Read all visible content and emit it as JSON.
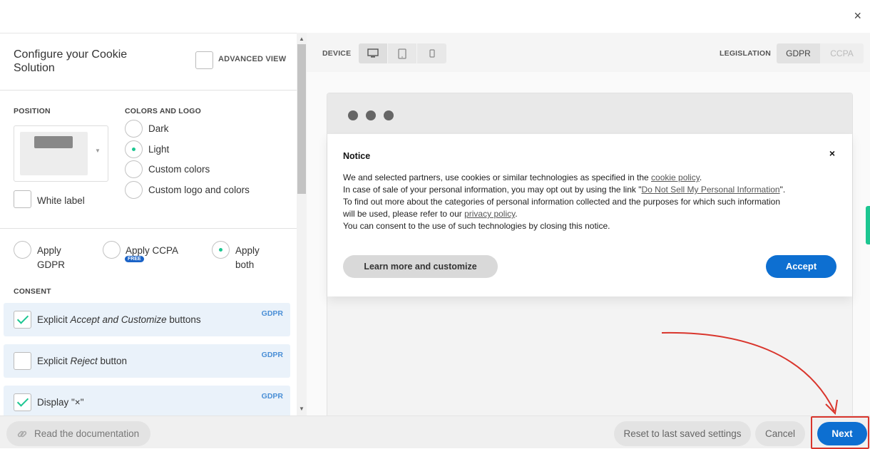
{
  "window": {
    "close_label": "×"
  },
  "left": {
    "title": "Configure your Cookie Solution",
    "advanced_view_label": "ADVANCED VIEW",
    "position": {
      "label": "POSITION",
      "white_label_text": "White label"
    },
    "colors": {
      "label": "COLORS AND LOGO",
      "options": [
        "Dark",
        "Light",
        "Custom colors",
        "Custom logo and colors"
      ],
      "selected": "Light"
    },
    "legislation_options": {
      "gdpr_line1": "Apply",
      "gdpr_line2": "GDPR",
      "ccpa": "Apply CCPA",
      "free_badge": "FREE",
      "both_line1": "Apply",
      "both_line2": "both",
      "selected": "both"
    },
    "consent": {
      "label": "CONSENT",
      "items": [
        {
          "pre": "Explicit ",
          "em": "Accept and Customize",
          "post": " buttons",
          "tag": "GDPR",
          "checked": true
        },
        {
          "pre": "Explicit ",
          "em": "Reject",
          "post": " button",
          "tag": "GDPR",
          "checked": false
        },
        {
          "pre": "Display \"×\"",
          "em": "",
          "post": "",
          "tag": "GDPR",
          "checked": true
        }
      ]
    }
  },
  "toolbar": {
    "device_label": "DEVICE",
    "devices": [
      "desktop-icon",
      "tablet-icon",
      "mobile-icon"
    ],
    "legislation_label": "LEGISLATION",
    "legislations": [
      "GDPR",
      "CCPA"
    ],
    "active_legislation": "GDPR"
  },
  "notice": {
    "title": "Notice",
    "close": "×",
    "line1_pre": "We and selected partners, use cookies or similar technologies as specified in the ",
    "line1_link": "cookie policy",
    "line1_post": ".",
    "line2_pre": "In case of sale of your personal information, you may opt out by using the link \"",
    "line2_link": "Do Not Sell My Personal Information",
    "line2_post": "\".",
    "line3": "To find out more about the categories of personal information collected and the purposes for which such information",
    "line4_pre": "will be used, please refer to our ",
    "line4_link": "privacy policy",
    "line4_post": ".",
    "line5": "You can consent to the use of such technologies by closing this notice.",
    "learn_more": "Learn more and customize",
    "accept": "Accept"
  },
  "footer": {
    "docs": "Read the documentation",
    "reset": "Reset to last saved settings",
    "cancel": "Cancel",
    "next": "Next"
  },
  "colors": {
    "accent_blue": "#0d6fd1",
    "accent_green": "#1cc691",
    "highlight_red": "#d9352c"
  }
}
